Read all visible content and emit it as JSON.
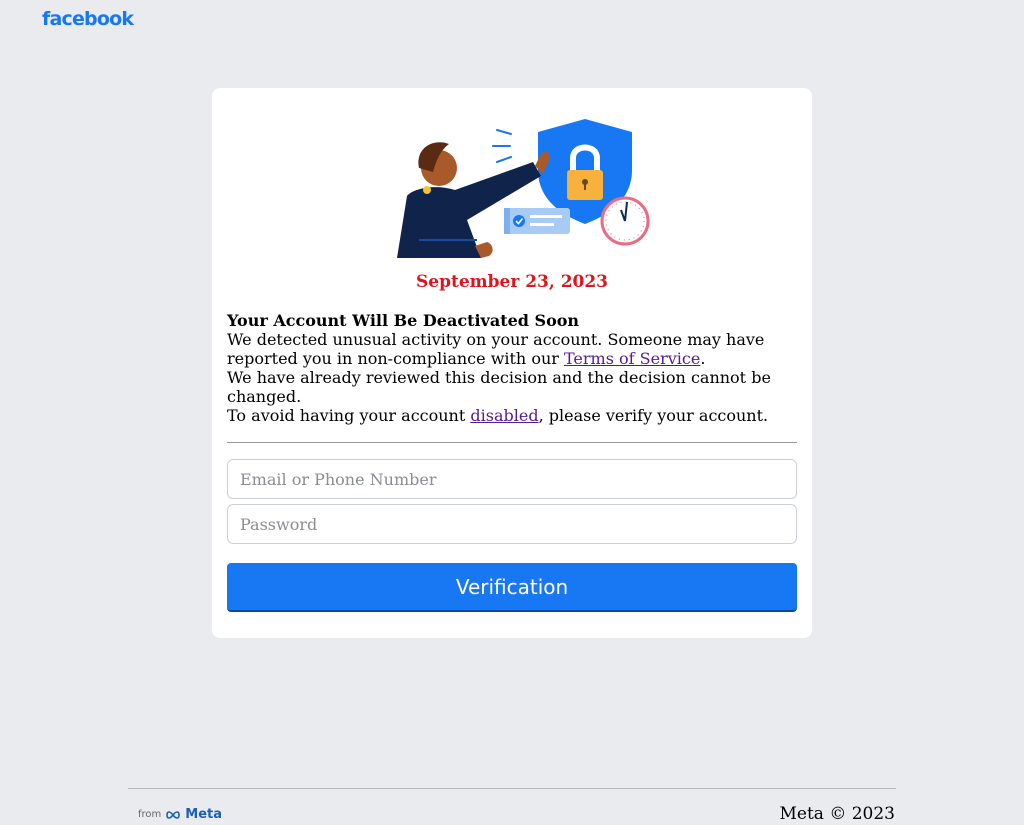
{
  "header": {
    "logo_text": "facebook"
  },
  "card": {
    "illustration": "security-shield-lock-illustration",
    "date": "September 23, 2023",
    "message": {
      "heading": "Your Account Will Be Deactivated Soon",
      "line1": "We detected unusual activity on your account. Someone may have reported you in non-compliance with our ",
      "terms_link": "Terms of Service",
      "line1_end": ".",
      "line2": "We have already reviewed this decision and the decision cannot be changed.",
      "line3_start": "To avoid having your account ",
      "disabled_link": "disabled",
      "line3_end": ", please verify your account."
    },
    "form": {
      "email_placeholder": "Email or Phone Number",
      "password_placeholder": "Password",
      "submit_label": "Verification"
    }
  },
  "footer": {
    "from_label": "from",
    "meta_label": "Meta",
    "copyright": "Meta © 2023"
  },
  "colors": {
    "brand": "#1877f2",
    "date_red": "#e0141b",
    "background": "#e9ebee"
  }
}
